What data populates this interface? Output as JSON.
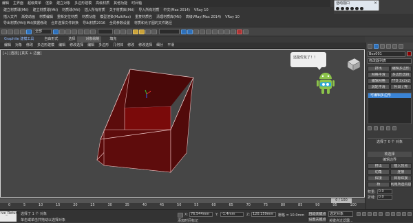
{
  "menu1": [
    "编辑",
    "主界面",
    "超级菜单",
    "渲染",
    "建立对象",
    "多边形建模",
    "高级材质",
    "其他功能",
    "时间轴"
  ],
  "menu2": [
    "建立材质球(Mtl)",
    "建立材质球(Mtl)",
    "材质球(Mtl)",
    "插入所有材质",
    "关于材质库(Mtl)",
    "导入所有材质",
    "中文(Max 2014)",
    "VRay 10"
  ],
  "menu3": [
    "插入文件",
    "渐变动画",
    "材质编辑",
    "重新定位材质",
    "材质功能",
    "模型渲染(MultiRes)",
    "重复材质名",
    "清理材质库(Mtl)",
    "高级VRay(Max 2014)",
    "VRay 10"
  ],
  "row4": [
    "导出材质(Mtl)(Mtl)数据修改",
    "合并选择文件转换",
    "导出材质2016",
    "全局参数设置",
    "材质和光子图的文件路径"
  ],
  "search_box": {
    "value": "全部"
  },
  "float_window": {
    "title": "活动视口"
  },
  "tabs": [
    "Graphite 建模工具",
    "自由形式",
    "选择",
    "对象绘制",
    "填充"
  ],
  "subtabs": [
    "编辑",
    "对象",
    "修改",
    "多边形建模",
    "编辑",
    "修改选择",
    "编辑",
    "多边形",
    "几何体",
    "修改",
    "修改选择",
    "细分",
    "平滑"
  ],
  "viewport": {
    "label": "[+] [透视] [真实 + 边面]"
  },
  "bubble": {
    "text": "还能优化了！！"
  },
  "right_panel": {
    "object_name": "Box001",
    "modifier_list": "修改器列表",
    "btn_rows": [
      [
        "挤出",
        "编辑多边形"
      ],
      [
        "网格平滑",
        "多边形选择"
      ],
      [
        "编辑网格",
        "FFD 2x2x2"
      ],
      [
        "涡轮平滑",
        "补洞 / 壳"
      ]
    ],
    "stack_item": "可编辑多边形",
    "status": "选择了 0 个 对象",
    "section_title": "软选择",
    "subsection": "编辑边界",
    "rows": [
      [
        "挤出",
        "插入顶点"
      ],
      [
        "切角",
        "连接"
      ],
      [
        "焊接",
        "目标焊接"
      ],
      [
        "桥",
        "利用所选内容创建图形"
      ]
    ],
    "weight_label": "权重:",
    "weight_value": "0.0",
    "crease_label": "折缝:",
    "crease_value": "0.0"
  },
  "timeline": {
    "frame": "0 / 100",
    "ticks": [
      "0",
      "5",
      "10",
      "15",
      "20",
      "25",
      "30",
      "35",
      "40",
      "45",
      "50",
      "55",
      "60",
      "65",
      "70",
      "75",
      "80",
      "85",
      "90",
      "95",
      "100"
    ]
  },
  "status_bar": {
    "sel": "选择了 1 个 对象",
    "hint": "单击或单击并拖动以选择对象",
    "x_label": "X:",
    "x_value": "76.544mm",
    "y_label": "Y:",
    "y_value": "-1.4mm",
    "z_label": "Z:",
    "z_value": "120.159mm",
    "grid": "栅格 = 10.0mm",
    "autokey": "自动关键点",
    "selected": "选定对象",
    "setkey": "设置关键点",
    "keyfilter": "关键点过滤器...",
    "addtime": "添加时间标记",
    "script": "ive_Return"
  },
  "colors": {
    "box_fill": "#5c0c0c",
    "box_inner": "#7a0a0a",
    "viewport_bg": "#464646",
    "accent": "#3a84d6"
  }
}
